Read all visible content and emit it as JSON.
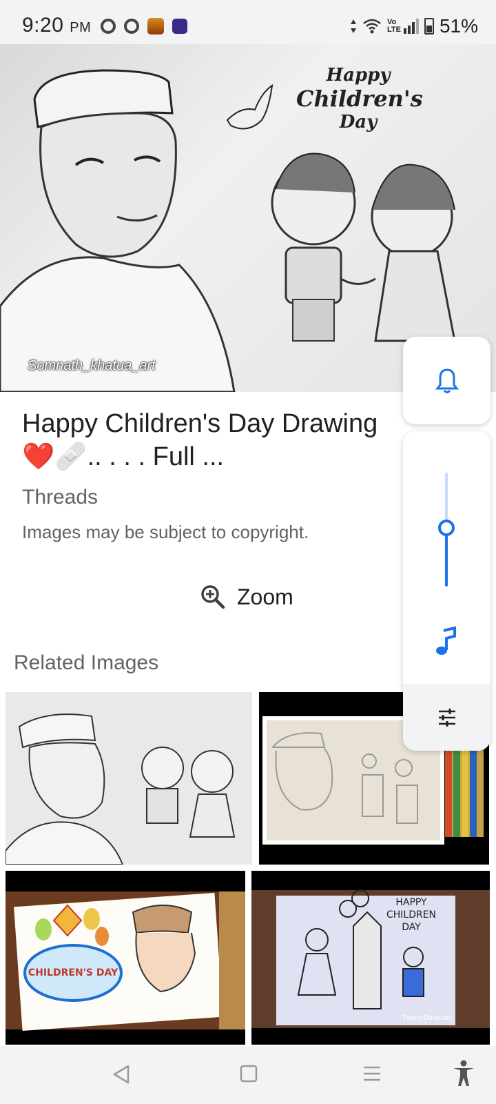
{
  "status_bar": {
    "time": "9:20",
    "ampm": "PM",
    "battery": "51%",
    "network_label": "Vo LTE"
  },
  "hero": {
    "title_lines": [
      "Happy",
      "Children's",
      "Day"
    ],
    "watermark": "Somnath_khatua_art"
  },
  "result": {
    "title": "Happy Children's Day Drawing ❤️🩹.. . . . Full ...",
    "source": "Threads",
    "copyright": "Images may be subject to copyright."
  },
  "zoom": {
    "label": "Zoom"
  },
  "related": {
    "heading": "Related Images",
    "thumb_3_text": "CHILDREN'S DAY",
    "thumb_4_text": [
      "HAPPY",
      "CHILDREN",
      "DAY"
    ],
    "thumb_4_watermark": "PowerDirector"
  },
  "volume_panel": {
    "level": 0.5,
    "accent": "#1a73e8",
    "icons": [
      "bell-icon",
      "music-note-icon",
      "tune-icon"
    ]
  },
  "nav_bar": {
    "icons": [
      "back-icon",
      "home-icon",
      "recents-icon",
      "accessibility-icon"
    ]
  }
}
